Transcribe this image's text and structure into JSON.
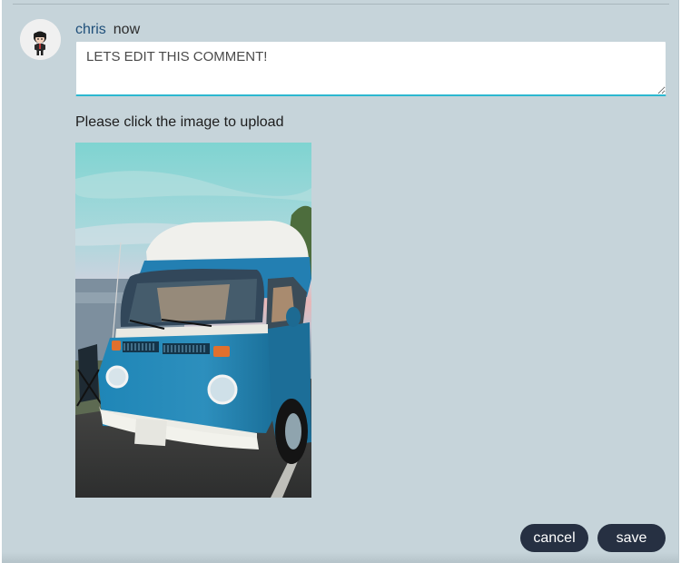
{
  "comment": {
    "author": "chris",
    "timestamp": "now",
    "avatar_icon": "avatar-character-icon",
    "text": "LETS EDIT THIS COMMENT!"
  },
  "upload": {
    "label": "Please click the image to upload",
    "image_subject": "blue-camper-van-photo"
  },
  "actions": {
    "cancel_label": "cancel",
    "save_label": "save"
  },
  "colors": {
    "panel_bg": "#c6d4da",
    "author": "#1f4f7a",
    "input_focus_border": "#2cb8d0",
    "button_bg": "#263042",
    "button_text": "#ffffff"
  }
}
